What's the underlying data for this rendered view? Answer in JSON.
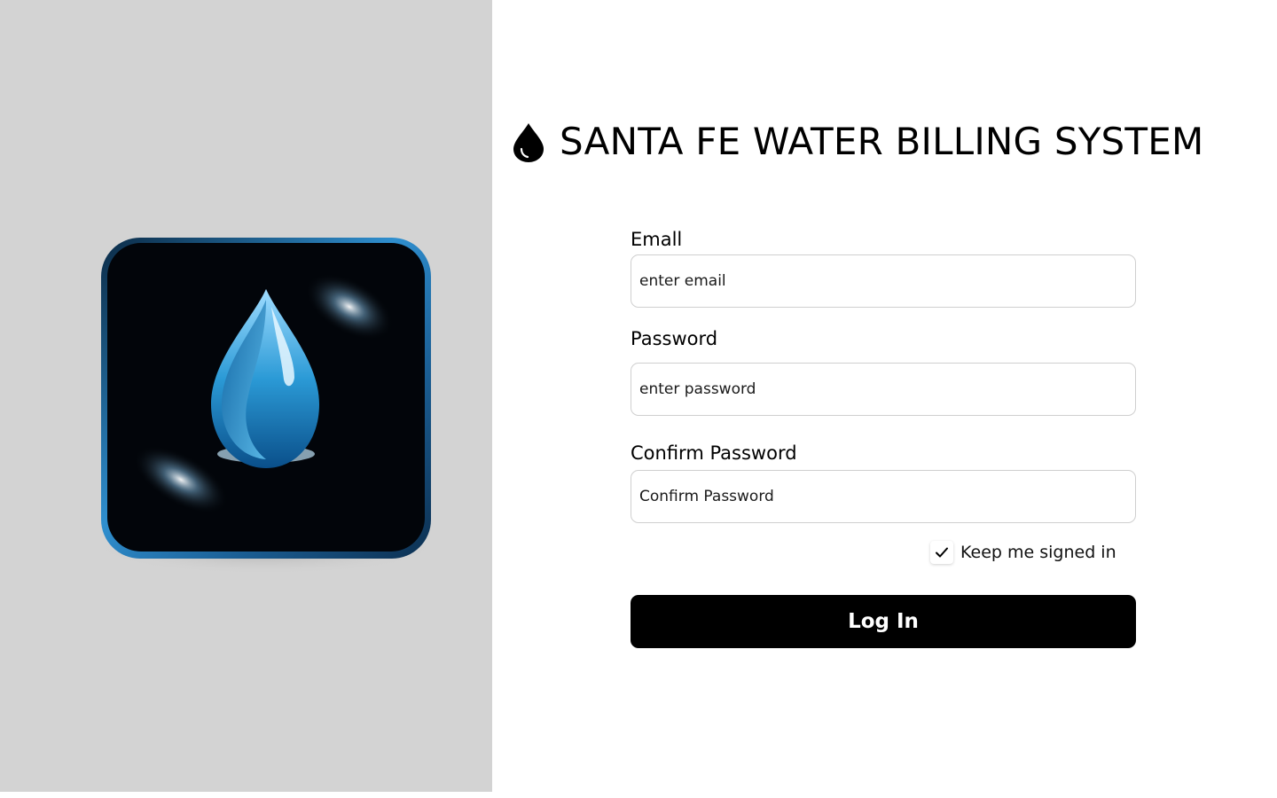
{
  "app": {
    "title": "SANTA FE WATER BILLING SYSTEM",
    "title_icon": "water-drop-icon",
    "logo_icon": "water-drop-app-logo"
  },
  "form": {
    "email": {
      "label": "Emall",
      "placeholder": "enter email",
      "value": ""
    },
    "password": {
      "label": "Password",
      "placeholder": "enter password",
      "value": ""
    },
    "confirm_password": {
      "label": "Confirm Password",
      "placeholder": "Confirm Password",
      "value": ""
    },
    "keep_signed_in": {
      "label": "Keep me signed in",
      "checked": true
    },
    "submit_label": "Log In"
  },
  "colors": {
    "left_panel_bg": "#d3d3d3",
    "page_bg": "#ffffff",
    "button_bg": "#000000",
    "button_text": "#ffffff",
    "input_border": "#cfcfcf",
    "logo_accent": "#3a9fd6"
  }
}
